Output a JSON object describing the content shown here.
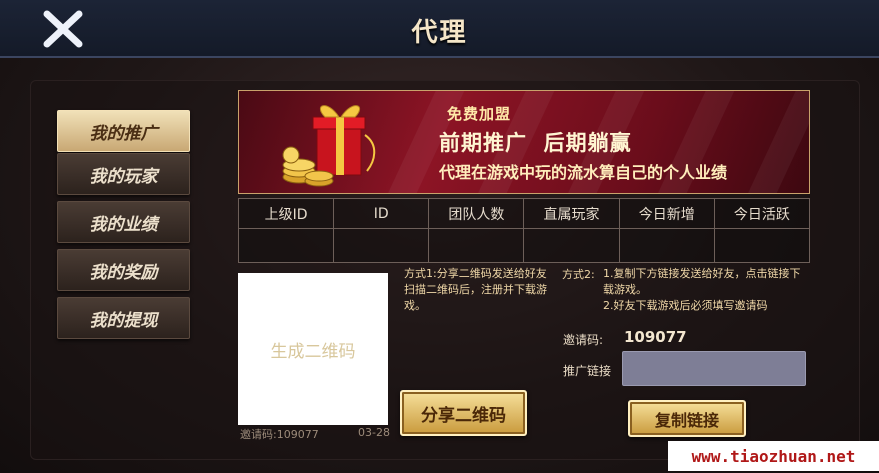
{
  "header": {
    "title": "代理",
    "close_icon": "close-icon"
  },
  "sidebar": {
    "items": [
      {
        "label": "我的推广",
        "active": true
      },
      {
        "label": "我的玩家",
        "active": false
      },
      {
        "label": "我的业绩",
        "active": false
      },
      {
        "label": "我的奖励",
        "active": false
      },
      {
        "label": "我的提现",
        "active": false
      }
    ]
  },
  "banner": {
    "line1": "免费加盟",
    "line2": "前期推广  后期躺赢",
    "line3": "代理在游戏中玩的流水算自己的个人业绩",
    "icon": "gift-box-gold-coins-icon"
  },
  "stats_table": {
    "headers": [
      "上级ID",
      "ID",
      "团队人数",
      "直属玩家",
      "今日新增",
      "今日活跃"
    ],
    "row": [
      "",
      "",
      "",
      "",
      "",
      ""
    ]
  },
  "qr": {
    "placeholder": "生成二维码",
    "footer_left": "邀请码:109077",
    "footer_right": "03-28"
  },
  "method1": {
    "text": "方式1:分享二维码发送给好友扫描二维码后，注册并下载游戏。"
  },
  "method2": {
    "label": "方式2:",
    "line1": "1.复制下方链接发送给好友，点击链接下载游戏。",
    "line2": "2.好友下载游戏后必须填写邀请码"
  },
  "share_button": "分享二维码",
  "invite": {
    "label": "邀请码:",
    "code": "109077"
  },
  "link": {
    "label": "推广链接",
    "value": ""
  },
  "copy_button": "复制链接",
  "watermark": "www.tiaozhuan.net",
  "colors": {
    "accent_gold": "#d9b15a",
    "banner_red": "#8d1425",
    "header_bg": "#1c2436"
  }
}
